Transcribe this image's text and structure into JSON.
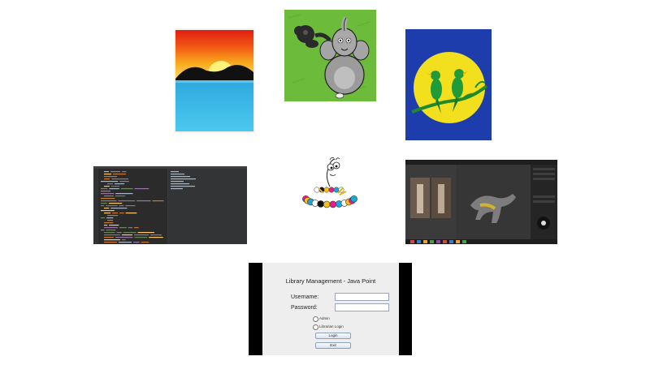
{
  "login_window": {
    "title": "Library Management - Java Point",
    "username_label": "Username:",
    "password_label": "Password:",
    "role_options": [
      "Admin",
      "Librarian Login"
    ],
    "login_button": "Login",
    "exit_button": "Exit"
  },
  "colors": {
    "page_background": "#ffffff",
    "elephant_background": "#6dbb3b",
    "birds_background": "#1f3aa8",
    "moon": "#f2df1d",
    "sea": "#33b7e8",
    "code_editor_background": "#2b2b2b",
    "login_panel": "#eeeeee"
  },
  "icons": [
    "sunset-painting",
    "elephant-cartoon",
    "birds-on-moon-painting",
    "code-editor-screenshot",
    "bead-mascot",
    "3d-modeling-screenshot",
    "java-login-window"
  ]
}
